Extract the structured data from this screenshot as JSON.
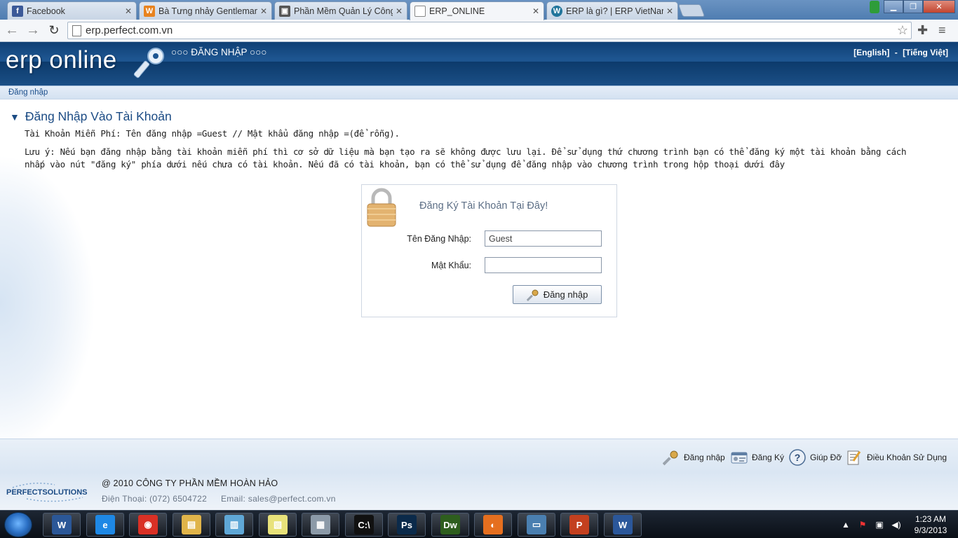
{
  "browser": {
    "tabs": [
      {
        "title": "Facebook",
        "icon": "facebook-icon",
        "color": "#3b5998",
        "glyph": "f"
      },
      {
        "title": "Bà Tưng nhảy Gentleman",
        "icon": "w-logo-icon",
        "color": "#e8831f",
        "glyph": "W"
      },
      {
        "title": "Phần Mềm Quản Lý Công",
        "icon": "camera-icon",
        "color": "#555555",
        "glyph": "▣"
      },
      {
        "title": "ERP_ONLINE",
        "icon": "page-icon",
        "color": "#ffffff",
        "glyph": ""
      },
      {
        "title": "ERP là gì? | ERP VietNam",
        "icon": "wordpress-icon",
        "color": "#21759b",
        "glyph": "W"
      }
    ],
    "url": "erp.perfect.com.vn"
  },
  "header": {
    "logo": "erp online",
    "title": "○○○ ĐĂNG NHẬP ○○○",
    "lang_english": "[English]",
    "lang_sep": "-",
    "lang_vietnamese": "[Tiếng Việt]"
  },
  "breadcrumb": "Đăng nhập",
  "main": {
    "title": "Đăng Nhập Vào Tài Khoản",
    "free_account": "Tài Khoản Miễn Phí: Tên đăng nhập =Guest // Mật khẩu đăng nhập =(để rỗng).",
    "note": "Lưu ý: Nếu bạn đăng nhập bằng tài khoản miễn phí thì cơ sở dữ liệu mà bạn tạo ra sẽ không được lưu lại. Để sử dụng thứ chương trình bạn có thể đăng ký một tài khoản bằng cách nhấp vào nút \"đăng ký\" phía dưới nếu chưa có tài khoản. Nếu đã có tài khoản, bạn có thể sử dụng để đăng nhập vào chương trình trong hộp thoại dưới đây"
  },
  "login_form": {
    "register_link": "Đăng Ký Tài Khoản Tại Đây!",
    "username_label": "Tên Đăng Nhập:",
    "username_value": "Guest",
    "password_label": "Mật Khẩu:",
    "password_value": "",
    "submit_label": "Đăng nhập"
  },
  "footer_links": {
    "login": "Đăng nhập",
    "register": "Đăng Ký",
    "help": "Giúp Đỡ",
    "terms": "Điều Khoản Sử Dụng"
  },
  "footer": {
    "logo": "PERFECTSOLUTIONS",
    "copyright": "@ 2010 CÔNG TY PHẦN MỀM HOÀN HẢO",
    "phone": "Điện Thoại:  (072) 6504722",
    "email": "Email: sales@perfect.com.vn"
  },
  "taskbar": {
    "apps": [
      {
        "name": "word-taskbar-icon",
        "color": "#2b5797",
        "glyph": "W"
      },
      {
        "name": "internet-explorer-icon",
        "color": "#1e88e5",
        "glyph": "e"
      },
      {
        "name": "chrome-icon",
        "color": "#d93025",
        "glyph": "◉"
      },
      {
        "name": "file-explorer-icon",
        "color": "#e0b44a",
        "glyph": "▤"
      },
      {
        "name": "notepad-icon",
        "color": "#5fa7d6",
        "glyph": "▥"
      },
      {
        "name": "sticky-notes-icon",
        "color": "#e8e27a",
        "glyph": "▧"
      },
      {
        "name": "calculator-icon",
        "color": "#8c9aa8",
        "glyph": "▦"
      },
      {
        "name": "command-prompt-icon",
        "color": "#111111",
        "glyph": "C:\\"
      },
      {
        "name": "photoshop-icon",
        "color": "#0b2a4a",
        "glyph": "Ps"
      },
      {
        "name": "dreamweaver-icon",
        "color": "#2e5e1e",
        "glyph": "Dw"
      },
      {
        "name": "firefox-icon",
        "color": "#e56f1f",
        "glyph": "◐"
      },
      {
        "name": "remote-desktop-icon",
        "color": "#4a7fb0",
        "glyph": "▭"
      },
      {
        "name": "powerpoint-icon",
        "color": "#c3401f",
        "glyph": "P"
      },
      {
        "name": "word-icon",
        "color": "#2b579a",
        "glyph": "W"
      }
    ],
    "time": "1:23 AM",
    "date": "9/3/2013"
  }
}
